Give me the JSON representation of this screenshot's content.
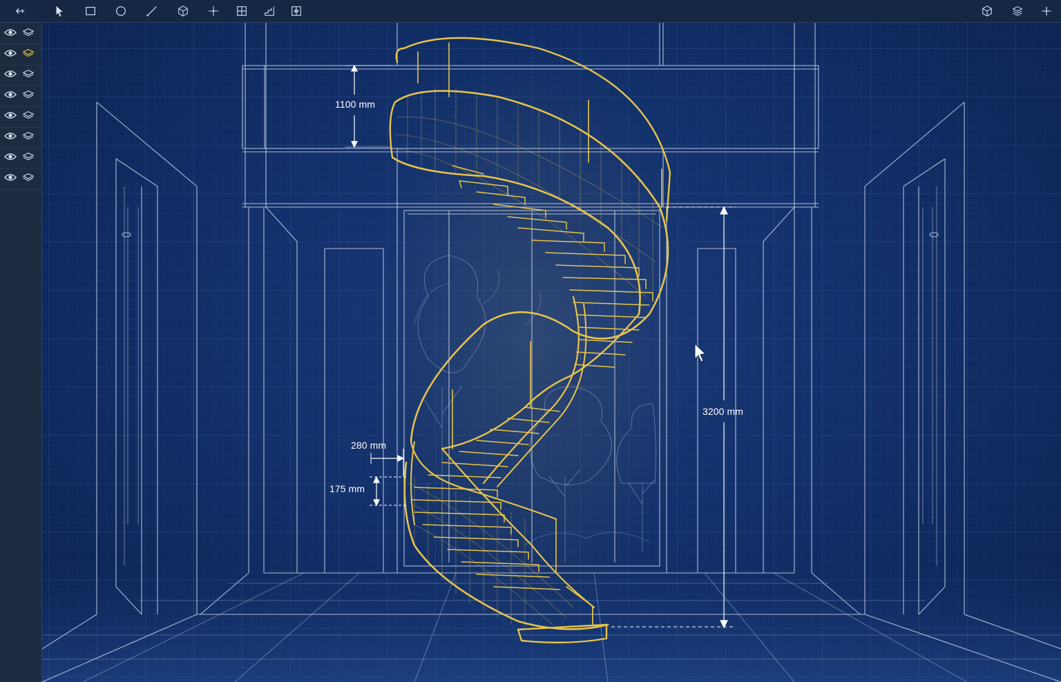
{
  "toolbar": {
    "left_tools": [
      "back-icon",
      "select-pointer-icon",
      "rectangle-icon",
      "circle-icon",
      "line-icon",
      "box-3d-icon",
      "crosshair-icon",
      "grid-icon",
      "stair-icon",
      "section-icon"
    ],
    "right_tools": [
      "view-cube-icon",
      "layers-3d-icon",
      "add-icon"
    ]
  },
  "layers": {
    "count": 8,
    "active_index": 1,
    "active_color": "#e8c44a",
    "icons": [
      "eye-icon",
      "layer-icon"
    ]
  },
  "dimensions": {
    "railing_height": "1100 mm",
    "total_height": "3200 mm",
    "tread_depth": "280 mm",
    "riser_height": "175 mm"
  },
  "colors": {
    "background": "#12306a",
    "grid": "#2e4f8e",
    "linework": "#c9d6ee",
    "stair_highlight": "#e8c44a",
    "toolbar": "#152742",
    "panel": "#1c2b3f"
  }
}
